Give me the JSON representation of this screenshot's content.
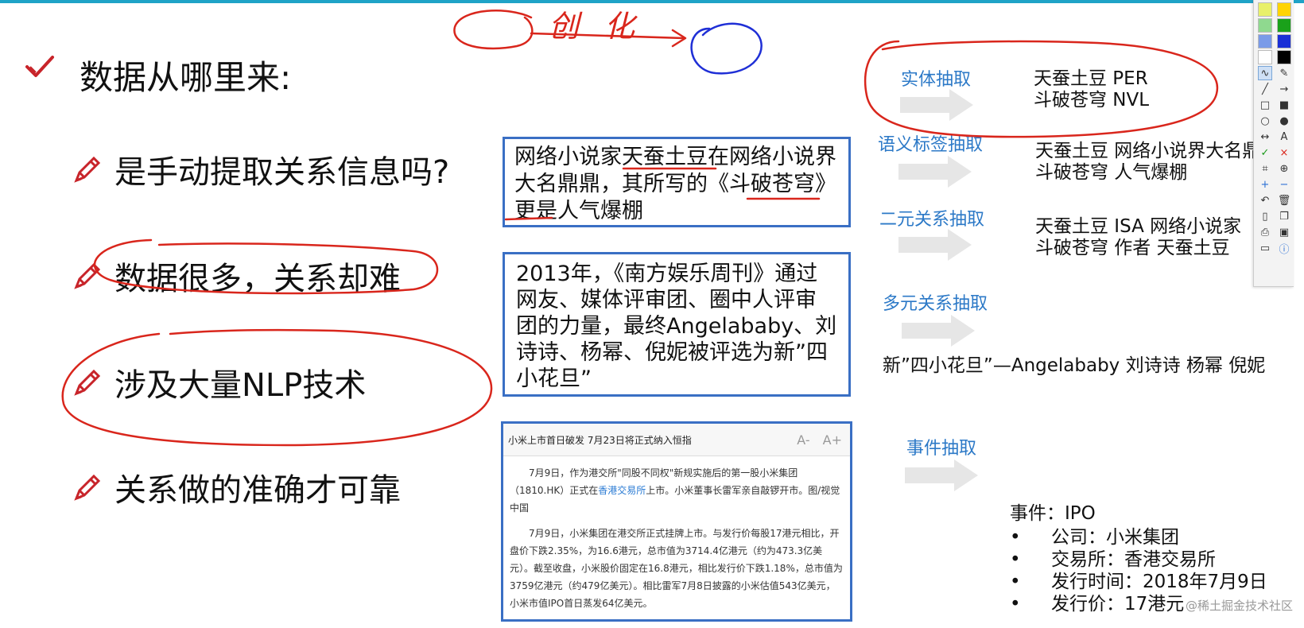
{
  "left": {
    "title": "数据从哪里来:",
    "bullets": [
      "是手动提取关系信息吗?",
      "数据很多，关系却难",
      "涉及大量NLP技术",
      "关系做的准确才可靠"
    ]
  },
  "annotation_top": "创 化",
  "box1": {
    "text": "网络小说家天蚕土豆在网络小说界大名鼎鼎，其所写的《斗破苍穹》更是人气爆棚"
  },
  "box2": {
    "text": "2013年，《南方娱乐周刊》通过网友、媒体评审团、圈中人评审团的力量，最终Angelababy、刘诗诗、杨幂、倪妮被评选为新”四小花旦”"
  },
  "box3": {
    "headline": "小米上市首日破发 7月23日将正式纳入恒指",
    "font_small": "A-",
    "font_large": "A+",
    "p1_a": "7月9日，作为港交所\"同股不同权\"新规实施后的第一股小米集团（1810.HK）正式在",
    "p1_link": "香港交易所",
    "p1_b": "上市。小米董事长雷军亲自敲锣开市。图/视觉中国",
    "p2": "7月9日，小米集团在港交所正式挂牌上市。与发行价每股17港元相比，开盘价下跌2.35%，为16.6港元，总市值为3714.4亿港元（约为473.3亿美元）。截至收盘，小米股价固定在16.8港元，相比发行价下跌1.18%，总市值为3759亿港元（约479亿美元）。相比雷军7月8日披露的小米估值543亿美元，小米市值IPO首日蒸发64亿美元。"
  },
  "right": {
    "entity_label": "实体抽取",
    "entity_l1": "天蚕土豆  PER",
    "entity_l2": "斗破苍穹  NVL",
    "semantic_label": "语义标签抽取",
    "semantic_l1": "天蚕土豆  网络小说界大名鼎",
    "semantic_l2": "斗破苍穹  人气爆棚",
    "binary_label": "二元关系抽取",
    "binary_l1": "天蚕土豆  ISA  网络小说家",
    "binary_l2": "斗破苍穹  作者  天蚕土豆",
    "multi_label": "多元关系抽取",
    "multi_text": "新”四小花旦”—Angelababy 刘诗诗 杨幂 倪妮",
    "event_label": "事件抽取",
    "event_title": "事件：IPO",
    "event_items": [
      "公司：小米集团",
      "交易所：香港交易所",
      "发行时间：2018年7月9日",
      "发行价：17港元"
    ]
  },
  "watermark": "@稀土掘金技术社区",
  "colors": {
    "accent_blue": "#2c79c7",
    "box_border": "#3a6fc4",
    "ink_red": "#d9261c",
    "ink_blue": "#1f2fd6",
    "topbar": "#1fa3c7"
  }
}
